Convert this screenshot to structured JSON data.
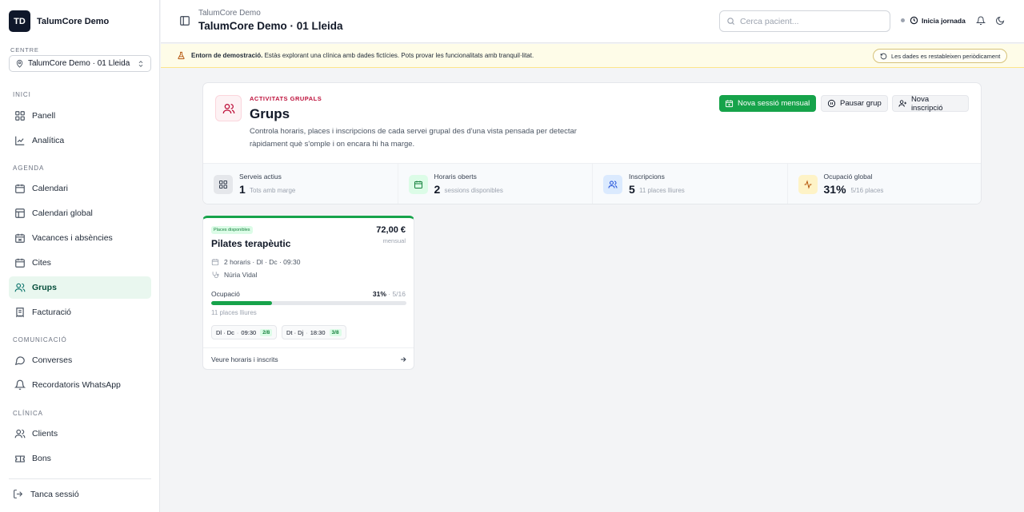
{
  "sidebar": {
    "brand_initials": "TD",
    "brand_name": "TalumCore Demo",
    "centre_label": "CENTRE",
    "centre_value": "TalumCore Demo · 01 Lleida",
    "sections": {
      "inici": "INICI",
      "agenda": "AGENDA",
      "comunicacio": "COMUNICACIÓ",
      "clinica": "CLÍNICA"
    },
    "items": {
      "panell": "Panell",
      "analitica": "Analítica",
      "calendari": "Calendari",
      "calendari_global": "Calendari global",
      "vacances": "Vacances i absències",
      "cites": "Cites",
      "grups": "Grups",
      "facturacio": "Facturació",
      "converses": "Converses",
      "recordatoris": "Recordatoris WhatsApp",
      "clients": "Clients",
      "bons": "Bons"
    },
    "logout": "Tanca sessió"
  },
  "header": {
    "subtitle": "TalumCore Demo",
    "title": "TalumCore Demo · 01 Lleida",
    "search_placeholder": "Cerca pacient...",
    "jornada": "Inicia jornada"
  },
  "banner": {
    "bold": "Entorn de demostració.",
    "text": " Estàs explorant una clínica amb dades fictícies. Pots provar les funcionalitats amb tranquil·litat.",
    "pill": "Les dades es restableixen periòdicament"
  },
  "page": {
    "eyebrow": "ACTIVITATS GRUPALS",
    "title": "Grups",
    "description": "Controla horaris, places i inscripcions de cada servei grupal des d'una vista pensada per detectar ràpidament què s'omple i on encara hi ha marge.",
    "buttons": {
      "new_session": "Nova sessió mensual",
      "pause": "Pausar grup",
      "new_enrollment": "Nova inscripció"
    },
    "stats": [
      {
        "label": "Serveis actius",
        "value": "1",
        "hint": "Tots amb marge"
      },
      {
        "label": "Horaris oberts",
        "value": "2",
        "hint": "sessions disponibles"
      },
      {
        "label": "Inscripcions",
        "value": "5",
        "hint": "11 places lliures"
      },
      {
        "label": "Ocupació global",
        "value": "31%",
        "hint": "5/16 places"
      }
    ]
  },
  "group": {
    "badge": "Places disponibles",
    "name": "Pilates terapèutic",
    "price": "72,00 €",
    "period": "mensual",
    "schedule": "2 horaris · Dl · Dc · 09:30",
    "therapist": "Núria Vidal",
    "occupancy_label": "Ocupació",
    "occupancy_pct": "31%",
    "occupancy_sep": " · ",
    "occupancy_count": "5/16",
    "occupancy_fraction": 0.31,
    "free": "11 places lliures",
    "slots": [
      {
        "days": "Dl · Dc",
        "time": "09:30",
        "count": "2/8"
      },
      {
        "days": "Dt · Dj",
        "time": "18:30",
        "count": "3/8"
      }
    ],
    "footer": "Veure horaris i inscrits"
  },
  "colors": {
    "accent_green": "#16a34a",
    "accent_rose": "#be123c",
    "banner_bg": "#fefce8"
  }
}
